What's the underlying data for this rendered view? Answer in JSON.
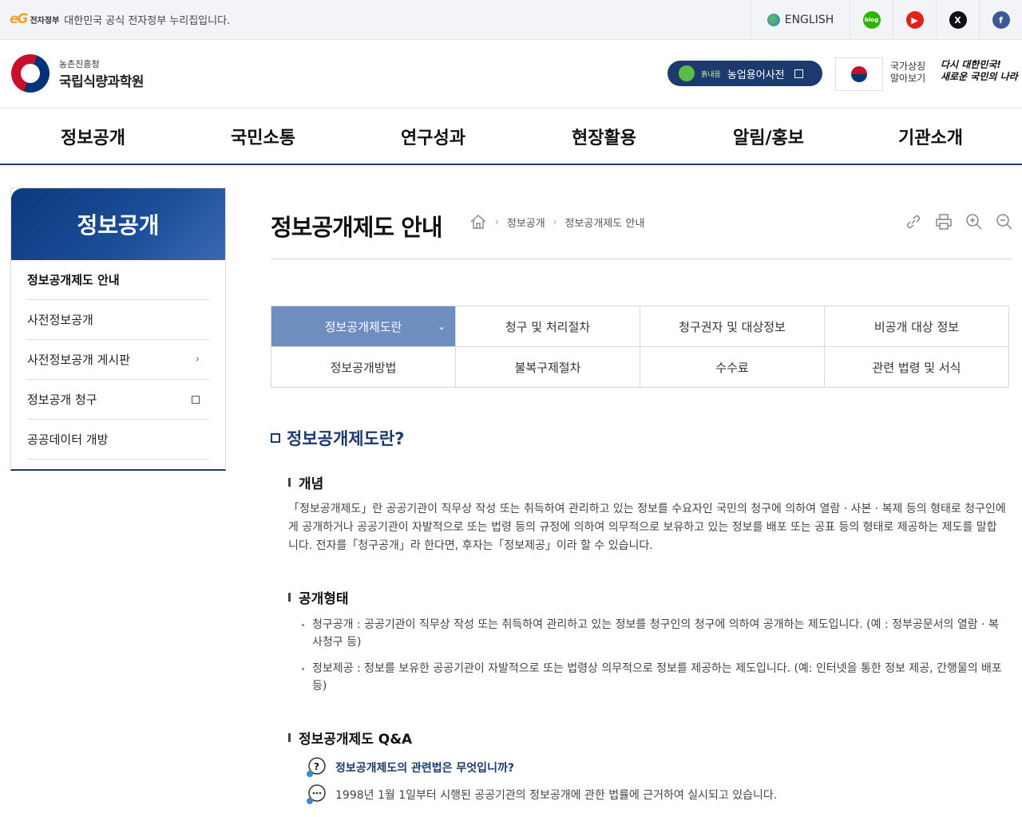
{
  "gov_bar": {
    "eg_logo": "eG",
    "eg_label": "전자정부",
    "description": "대한민국 공식 전자정부 누리집입니다.",
    "english": "ENGLISH",
    "sns": [
      {
        "name": "blog",
        "label": "blog"
      },
      {
        "name": "youtube",
        "label": "▶"
      },
      {
        "name": "x",
        "label": "X"
      },
      {
        "name": "facebook",
        "label": "f"
      }
    ]
  },
  "header": {
    "org_sub": "농촌진흥청",
    "org_main": "국립식량과학원",
    "dict_small": "흙내음",
    "dict_label": "농업용어사전",
    "flag_text_1": "국가상징",
    "flag_text_2": "알아보기",
    "slogan_1": "다시 대한민국!",
    "slogan_2": "새로운 국민의 나라"
  },
  "gnb": [
    "정보공개",
    "국민소통",
    "연구성과",
    "현장활용",
    "알림/홍보",
    "기관소개"
  ],
  "lnb": {
    "title": "정보공개",
    "items": [
      {
        "label": "정보공개제도 안내",
        "active": true,
        "icon": ""
      },
      {
        "label": "사전정보공개",
        "active": false,
        "icon": ""
      },
      {
        "label": "사전정보공개 게시판",
        "active": false,
        "icon": "chevron-right"
      },
      {
        "label": "정보공개 청구",
        "active": false,
        "icon": "new-window"
      },
      {
        "label": "공공데이터 개방",
        "active": false,
        "icon": ""
      }
    ]
  },
  "page": {
    "title": "정보공개제도 안내",
    "breadcrumb": [
      "정보공개",
      "정보공개제도 안내"
    ]
  },
  "tabs": [
    {
      "label": "정보공개제도란",
      "active": true
    },
    {
      "label": "청구 및 처리절차",
      "active": false
    },
    {
      "label": "청구권자 및 대상정보",
      "active": false
    },
    {
      "label": "비공개 대상 정보",
      "active": false
    },
    {
      "label": "정보공개방법",
      "active": false
    },
    {
      "label": "불복구제절차",
      "active": false
    },
    {
      "label": "수수료",
      "active": false
    },
    {
      "label": "관련 법령 및 서식",
      "active": false
    }
  ],
  "content": {
    "heading": "정보공개제도란?",
    "concept_title": "개념",
    "concept_text": "「정보공개제도」란 공공기관이 직무상 작성 또는 취득하여 관리하고 있는 정보를 수요자인 국민의 청구에 의하여 열람 · 사본 · 복제 등의 형태로 청구인에게 공개하거나 공공기관이 자발적으로 또는 법령 등의 규정에 의하여 의무적으로 보유하고 있는 정보를 배포 또는 공표 등의 형태로 제공하는 제도를 말합니다. 전자를「청구공개」라 한다면, 후자는「정보제공」이라 할 수 있습니다.",
    "type_title": "공개형태",
    "type_items": [
      "청구공개 : 공공기관이 직무상 작성 또는 취득하여 관리하고 있는 정보를 청구인의 청구에 의하여 공개하는 제도입니다. (예 : 정부공문서의 열람 · 복사청구 등)",
      "정보제공 : 정보를 보유한 공공기관이 자발적으로 또는 법령상 의무적으로 정보를 제공하는 제도입니다. (예: 인터넷을 통한 정보 제공, 간행물의 배포 등)"
    ],
    "qa_title": "정보공개제도 Q&A",
    "qa_question": "정보공개제도의 관련법은 무엇입니까?",
    "qa_answer": "1998년 1월 1일부터 시행된 공공기관의 정보공개에 관한 법률에 근거하여 실시되고 있습니다."
  },
  "colors": {
    "brand_navy": "#1c3a6e",
    "tab_active": "#6f8ec0"
  }
}
